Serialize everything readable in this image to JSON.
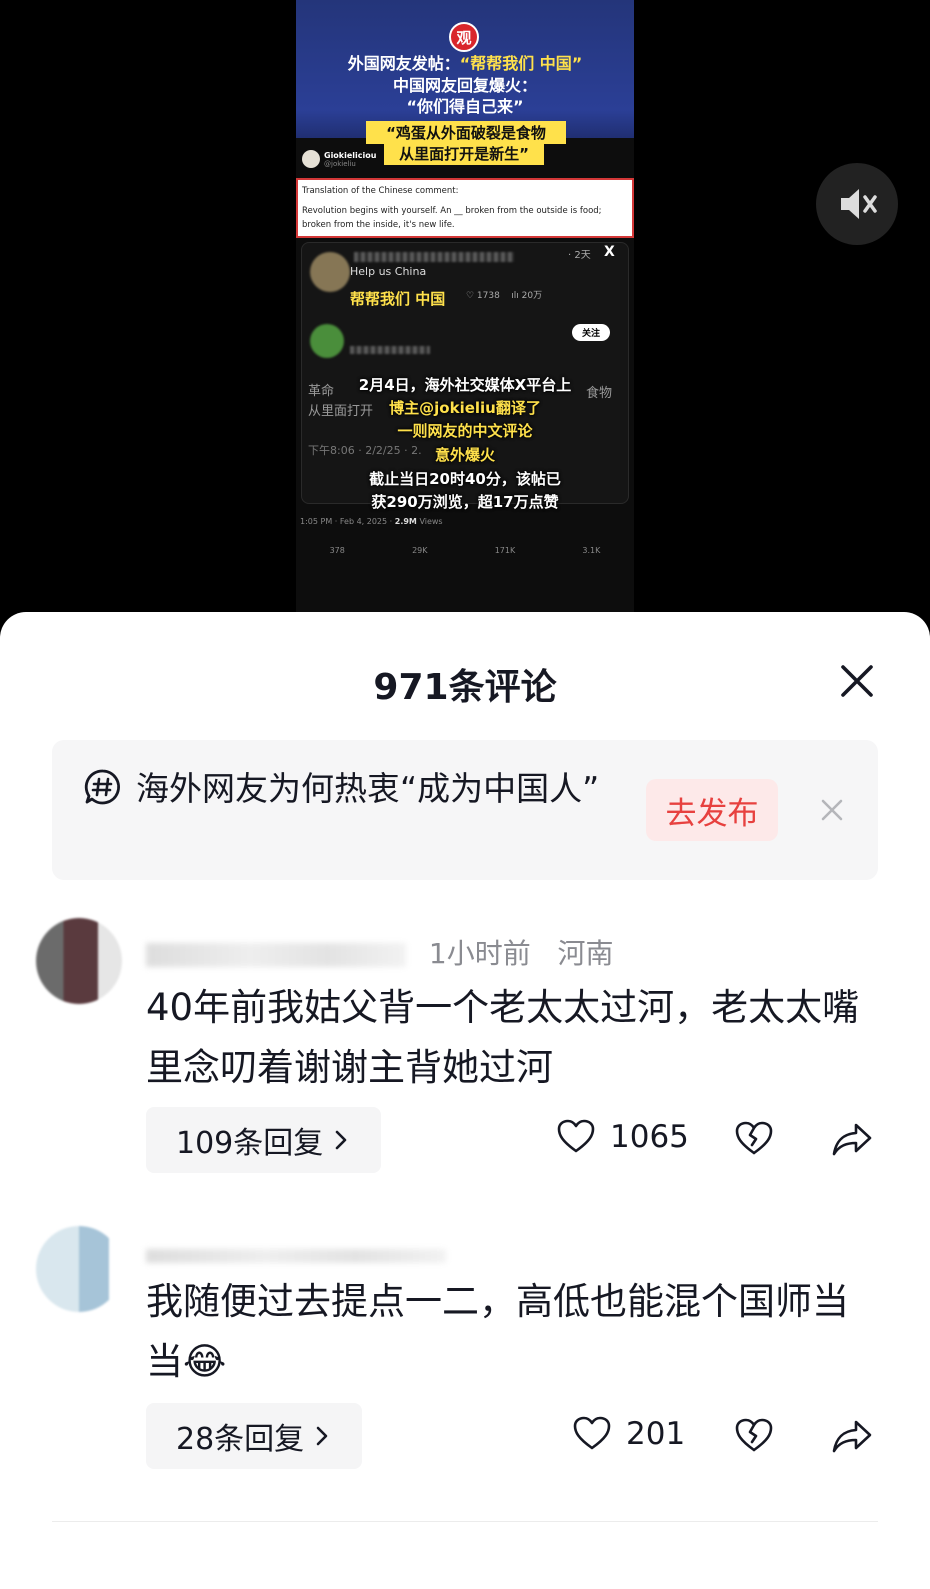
{
  "video": {
    "logo_char": "观",
    "headline_1a": "外国网友发帖：",
    "headline_1b": "“帮帮我们 中国”",
    "headline_2": "中国网友回复爆火：",
    "headline_3": "“你们得自己来”",
    "quote_1": "“鸡蛋从外面破裂是食物",
    "quote_2": "从里面打开是新生”",
    "tweet_user": "Giokieliciou",
    "tweet_handle": "@jokieliu",
    "translation_line1": "Translation of the Chinese comment:",
    "translation_line2": "Revolution begins with yourself. An __ broken from the outside is food;",
    "translation_line3": "broken from the inside, it's new life.",
    "post_time": "· 2天",
    "post_x": "X",
    "help_us": "Help us China",
    "help_cn": "帮帮我们 中国",
    "stat_likes": "♡ 1738",
    "stat_views": "ılı 20万",
    "follow": "关注",
    "body_line1": "革命",
    "body_line2": "从里面打开",
    "body_line1_end": "食物",
    "overlay_1": "2月4日，海外社交媒体X平台上",
    "overlay_2": "博主@jokieliu翻译了",
    "overlay_3": "一则网友的中文评论",
    "overlay_4": "意外爆火",
    "overlay_5": "截止当日20时40分，该帖已",
    "overlay_6": "获290万浏览，超17万点赞",
    "time_line": "下午8:06 · 2/2/25 · 2.",
    "meta_time": "1:05 PM · Feb 4, 2025 ·",
    "meta_views": "2.9M",
    "meta_views_label": "Views",
    "act_replies": "378",
    "act_retweets": "29K",
    "act_likes": "171K",
    "act_bookmarks": "3.1K"
  },
  "sheet": {
    "title": "971条评论",
    "topic_text": "海外网友为何热衷“成为中国人”",
    "publish_label": "去发布"
  },
  "comments": [
    {
      "meta_time": "1小时前",
      "meta_region": "河南",
      "text": "40年前我姑父背一个老太太过河，老太太嘴里念叨着谢谢主背她过河",
      "replies": "109条回复",
      "likes": "1065"
    },
    {
      "text": "我随便过去提点一二，高低也能混个国师当当",
      "emoji": "😂",
      "replies": "28条回复",
      "likes": "201"
    }
  ],
  "colors": {
    "accent_red": "#e7413f",
    "publish_bg": "#fde9e9",
    "text_main": "#161823",
    "text_meta": "#8a8b91",
    "highlight_yellow": "#ffe14b"
  },
  "icons": {
    "mute": "speaker-muted-icon",
    "close": "close-icon",
    "topic": "hashtag-bubble-icon",
    "like": "heart-icon",
    "dislike": "broken-heart-icon",
    "share": "share-arrow-icon",
    "chevron": "chevron-right-icon"
  }
}
